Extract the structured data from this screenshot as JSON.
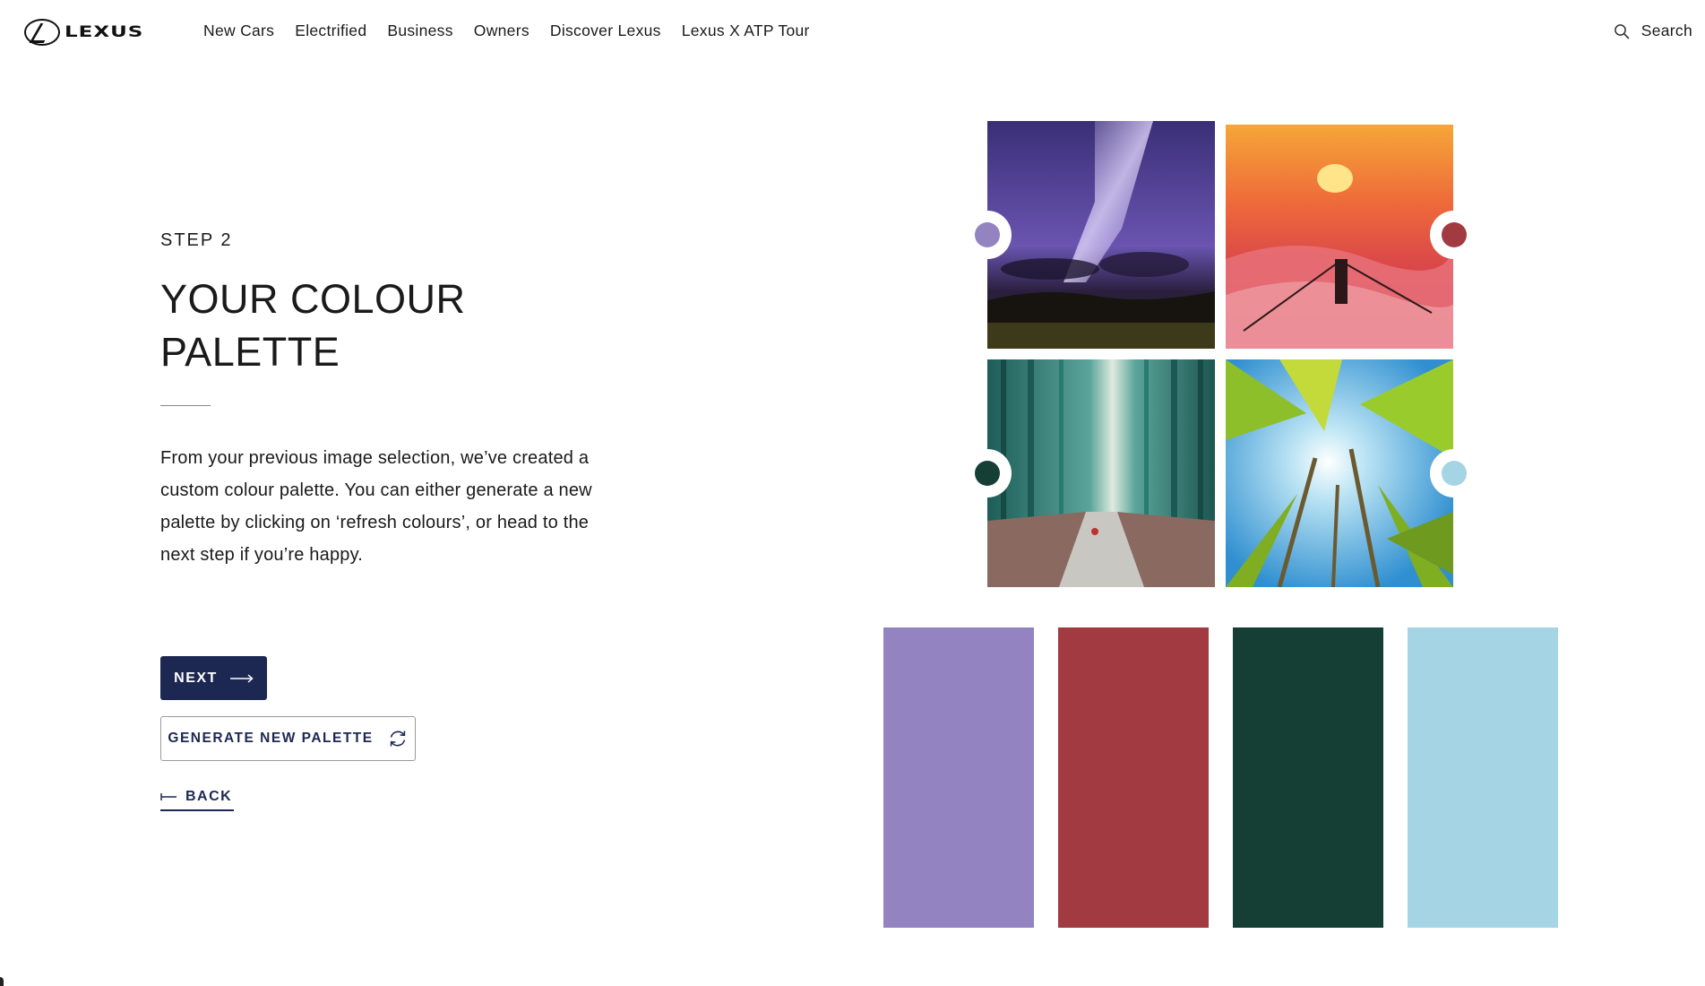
{
  "brand": {
    "name": "LEXUS"
  },
  "nav": {
    "items": [
      {
        "label": "New Cars"
      },
      {
        "label": "Electrified"
      },
      {
        "label": "Business"
      },
      {
        "label": "Owners"
      },
      {
        "label": "Discover Lexus"
      },
      {
        "label": "Lexus X ATP Tour"
      }
    ],
    "search_label": "Search"
  },
  "main": {
    "step": "STEP 2",
    "title": "YOUR COLOUR PALETTE",
    "description": "From your previous image selection, we’ve created a custom colour palette. You can either generate a new palette by clicking on ‘refresh colours’, or head to the next step if you’re happy.",
    "buttons": {
      "next_label": "NEXT",
      "generate_label": "GENERATE NEW PALETTE",
      "back_label": "BACK"
    }
  },
  "images": [
    {
      "subject": "milky-way-night-sky",
      "dot_color": "#9383c0"
    },
    {
      "subject": "sunset-bridge-in-fog",
      "dot_color": "#a23a42"
    },
    {
      "subject": "bamboo-forest-path",
      "dot_color": "#153f35"
    },
    {
      "subject": "palm-trees-blue-sky",
      "dot_color": "#a5d4e4"
    }
  ],
  "palette": [
    {
      "color": "#9383c0"
    },
    {
      "color": "#a23a42"
    },
    {
      "color": "#153f35"
    },
    {
      "color": "#a5d4e4"
    }
  ],
  "colors": {
    "primary_button": "#1d2852",
    "text": "#1a1a1a"
  }
}
